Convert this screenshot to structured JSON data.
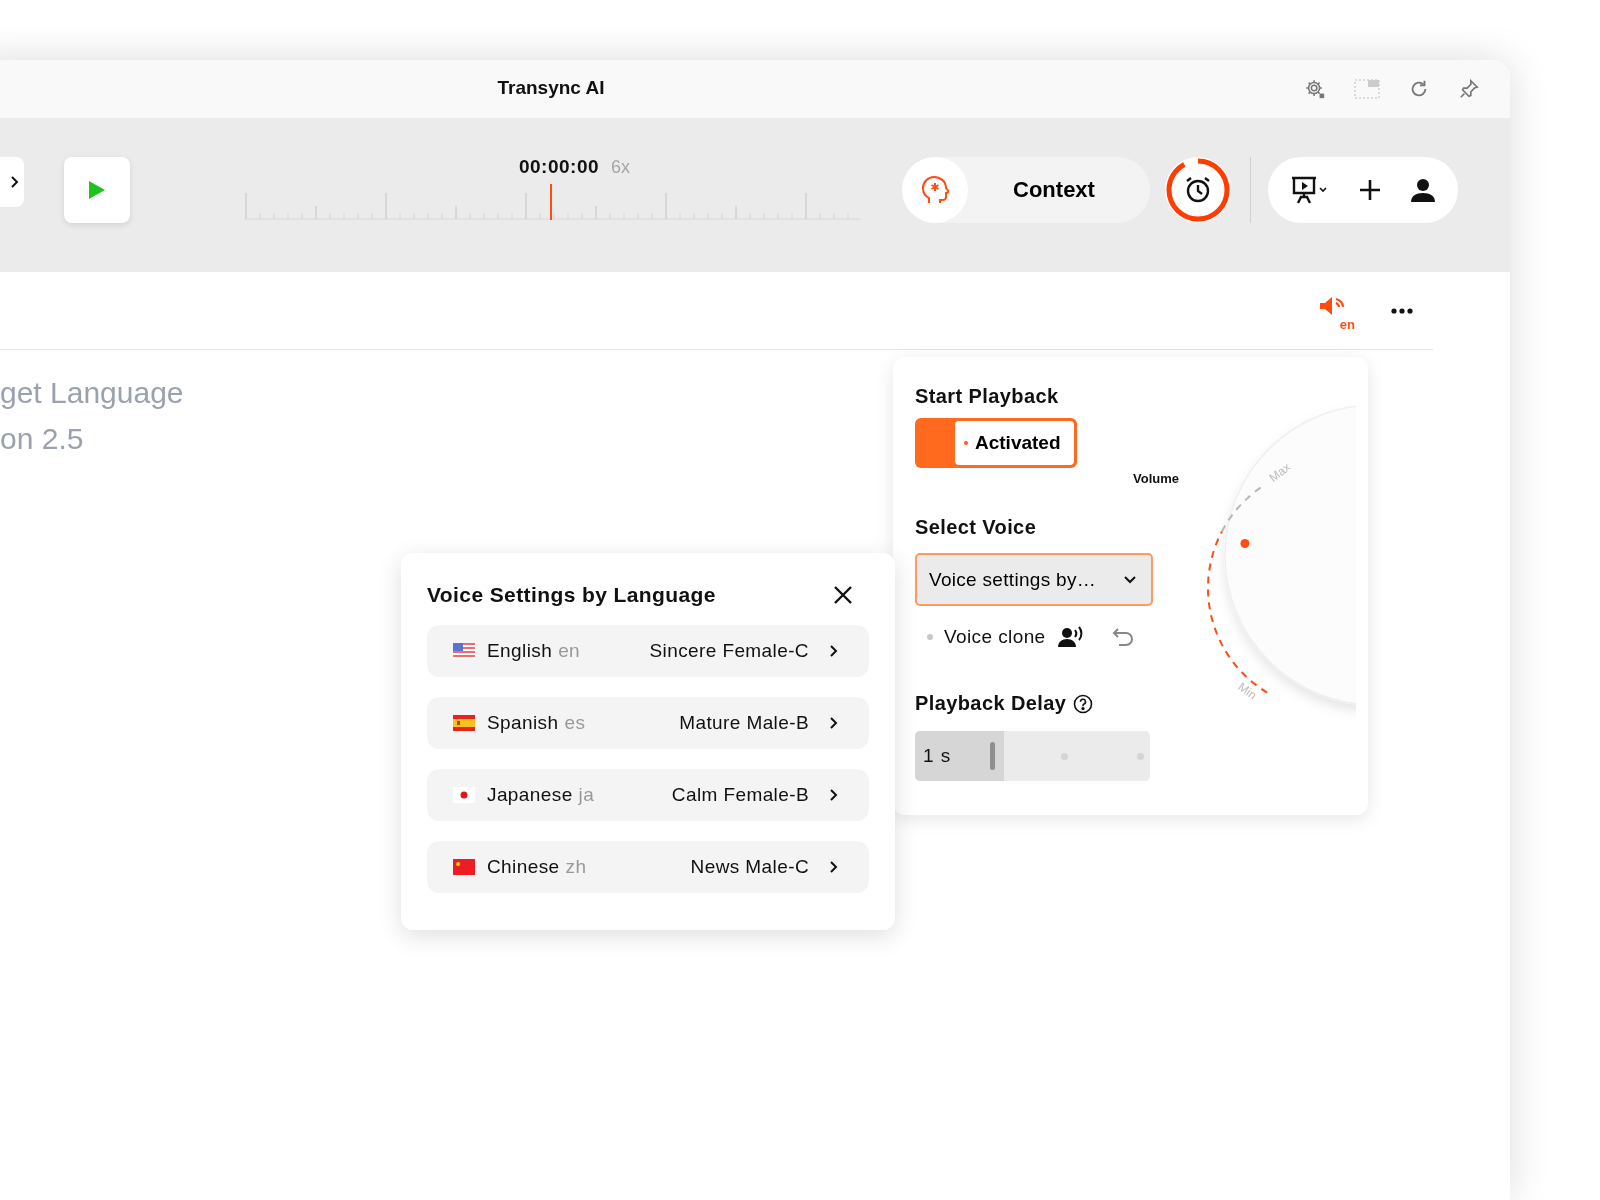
{
  "window": {
    "title": "Transync AI"
  },
  "toolbar": {
    "time": "00:00:00",
    "speed": "6x",
    "context_button": {
      "label": "Context"
    }
  },
  "card": {
    "language_badge": "en",
    "text_lines": [
      "get Language",
      "on 2.5"
    ]
  },
  "playback_panel": {
    "start_playback": {
      "title": "Start Playback",
      "toggle_label": "Activated",
      "on": true
    },
    "volume": {
      "label": "Volume",
      "max_label": "Max",
      "min_label": "Min",
      "level": 0.74
    },
    "select_voice": {
      "title": "Select Voice",
      "value": "Voice settings by…",
      "voice_clone": {
        "label": "Voice clone",
        "on": false
      }
    },
    "playback_delay": {
      "title": "Playback Delay",
      "value": "1 s",
      "level": 0.38
    }
  },
  "voice_dialog": {
    "title": "Voice Settings by Language",
    "languages": [
      {
        "kind": "us",
        "name": "English",
        "code": "en",
        "voice": "Sincere Female-C"
      },
      {
        "kind": "es",
        "name": "Spanish",
        "code": "es",
        "voice": "Mature Male-B"
      },
      {
        "kind": "jp",
        "name": "Japanese",
        "code": "ja",
        "voice": "Calm Female-B"
      },
      {
        "kind": "cn",
        "name": "Chinese",
        "code": "zh",
        "voice": "News Male-C"
      }
    ]
  }
}
